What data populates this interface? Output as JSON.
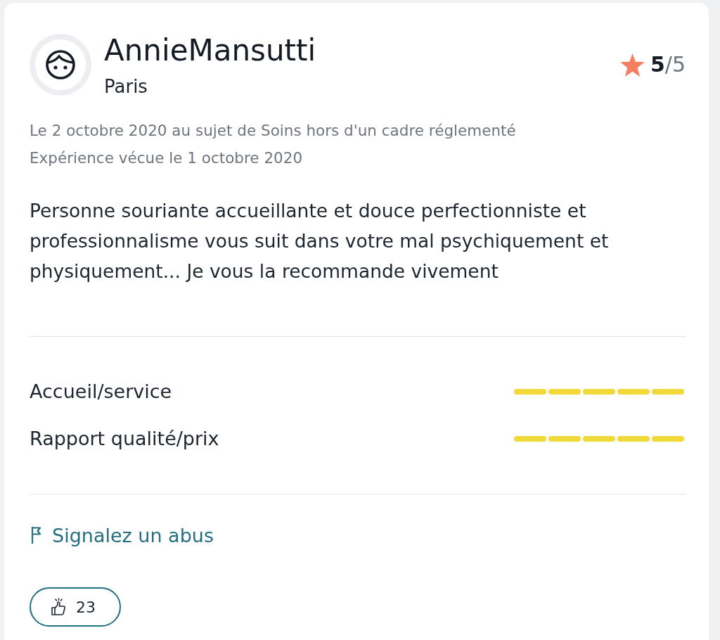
{
  "review": {
    "author": {
      "name": "AnnieMansutti",
      "city": "Paris"
    },
    "score": "**5**/5",
    "meta": [
      "Le 2 octobre 2020 au sujet de Soins hors d'un cadre réglementé",
      "Expérience vécue le 1 octobre 2020"
    ],
    "text": "Personne souriante accueillante et douce perfectionniste et professionnalisme vous suit dans votre mal psychiquement et physiquement... Je vous la recommande vivement",
    "criteria": [
      {
        "label": "Accueil/service",
        "stars": 5
      },
      {
        "label": "Rapport qualité/prix",
        "stars": 5
      }
    ],
    "report_link": "Signalez un abus",
    "like_button": {
      "count": "23"
    }
  }
}
